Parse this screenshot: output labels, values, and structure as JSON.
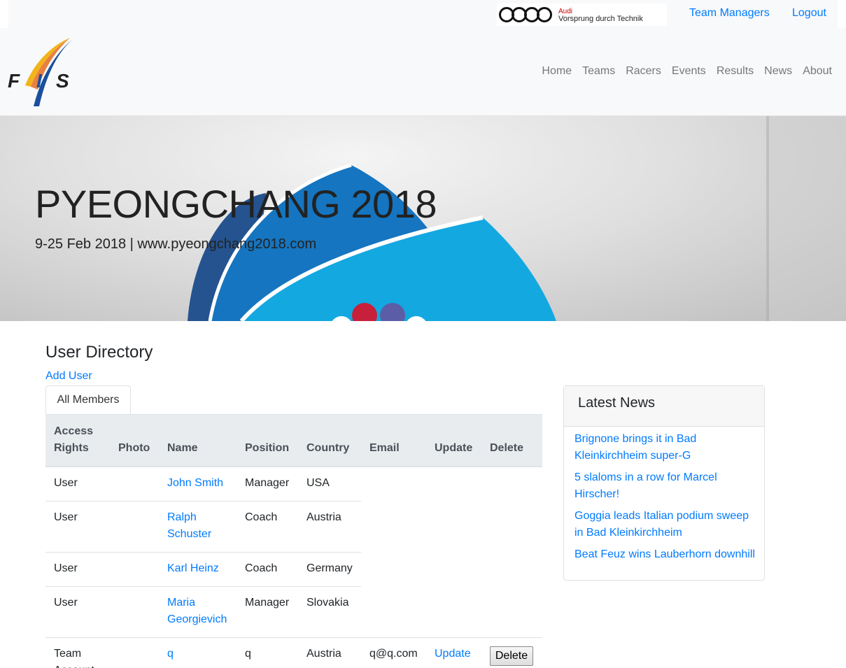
{
  "topbar": {
    "sponsor": {
      "brand": "Audi",
      "slogan": "Vorsprung durch Technik"
    },
    "links": [
      "Team Managers",
      "Logout"
    ]
  },
  "logo": {
    "letters": [
      "F",
      "I",
      "S"
    ]
  },
  "nav": {
    "items": [
      "Home",
      "Teams",
      "Racers",
      "Events",
      "Results",
      "News",
      "About"
    ]
  },
  "hero": {
    "title": "PYEONGCHANG 2018",
    "subtitle": "9-25 Feb 2018 | www.pyeongchang2018.com"
  },
  "directory": {
    "heading": "User Directory",
    "add_user": "Add User",
    "tab": "All Members",
    "columns": {
      "access_rights": "Access Rights",
      "photo": "Photo",
      "name": "Name",
      "position": "Position",
      "country": "Country",
      "email": "Email",
      "update": "Update",
      "delete": "Delete"
    },
    "rows": [
      {
        "access": "User",
        "name": "John Smith",
        "position": "Manager",
        "country": "USA",
        "email": "",
        "update": "",
        "delete": ""
      },
      {
        "access": "User",
        "name": "Ralph Schuster",
        "position": "Coach",
        "country": "Austria",
        "email": "",
        "update": "",
        "delete": ""
      },
      {
        "access": "User",
        "name": "Karl Heinz",
        "position": "Coach",
        "country": "Germany",
        "email": "",
        "update": "",
        "delete": ""
      },
      {
        "access": "User",
        "name": "Maria Georgievich",
        "position": "Manager",
        "country": "Slovakia",
        "email": "",
        "update": "",
        "delete": ""
      },
      {
        "access": "Team Account",
        "name": "q",
        "position": "q",
        "country": "Austria",
        "email": "q@q.com",
        "update": "Update",
        "delete": "Delete"
      }
    ]
  },
  "news": {
    "heading": "Latest News",
    "items": [
      "Brignone brings it in Bad Kleinkirchheim super-G",
      "5 slaloms in a row for Marcel Hirscher!",
      "Goggia leads Italian podium sweep in Bad Kleinkirchheim",
      "Beat Feuz wins Lauberhorn downhill"
    ]
  },
  "colors": {
    "link": "#007bff",
    "navbar_bg": "#f8f9fa",
    "table_head_bg": "#e9ecef"
  }
}
